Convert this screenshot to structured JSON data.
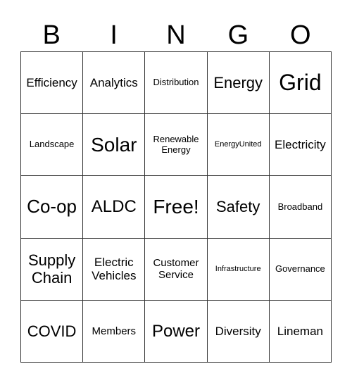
{
  "header": [
    "B",
    "I",
    "N",
    "G",
    "O"
  ],
  "cells": [
    [
      "Efficiency",
      "Analytics",
      "Distribution",
      "Energy",
      "Grid"
    ],
    [
      "Landscape",
      "Solar",
      "Renewable Energy",
      "EnergyUnited",
      "Electricity"
    ],
    [
      "Co-op",
      "ALDC",
      "Free!",
      "Safety",
      "Broadband"
    ],
    [
      "Supply Chain",
      "Electric Vehicles",
      "Customer Service",
      "Infrastructure",
      "Governance"
    ],
    [
      "COVID",
      "Members",
      "Power",
      "Diversity",
      "Lineman"
    ]
  ]
}
